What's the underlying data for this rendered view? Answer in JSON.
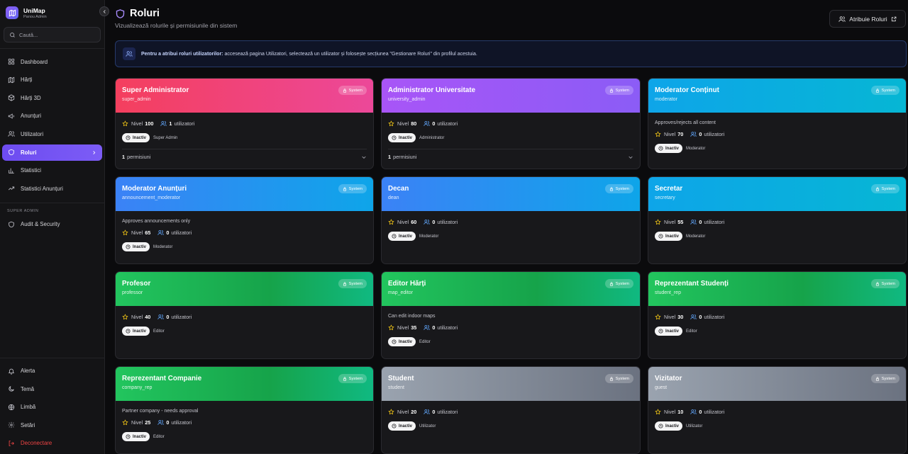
{
  "brand": {
    "name": "UniMap",
    "subtitle": "Panou Admin"
  },
  "search": {
    "placeholder": "Caută..."
  },
  "sidebar": {
    "items": [
      {
        "label": "Dashboard",
        "icon": "dashboard-icon"
      },
      {
        "label": "Hărți",
        "icon": "map-icon"
      },
      {
        "label": "Hărți 3D",
        "icon": "cube-icon"
      },
      {
        "label": "Anunțuri",
        "icon": "megaphone-icon"
      },
      {
        "label": "Utilizatori",
        "icon": "users-icon"
      },
      {
        "label": "Roluri",
        "icon": "shield-icon",
        "active": true
      },
      {
        "label": "Statistici",
        "icon": "bar-chart-icon"
      },
      {
        "label": "Statistici Anunțuri",
        "icon": "trend-icon"
      }
    ],
    "section_label": "SUPER ADMIN",
    "admin_items": [
      {
        "label": "Audit & Security",
        "icon": "shield-icon"
      }
    ],
    "bottom_items": [
      {
        "label": "Alerta",
        "icon": "bell-icon"
      },
      {
        "label": "Temă",
        "icon": "moon-icon"
      },
      {
        "label": "Limbă",
        "icon": "globe-icon"
      },
      {
        "label": "Setări",
        "icon": "gear-icon"
      },
      {
        "label": "Deconectare",
        "icon": "logout-icon"
      }
    ]
  },
  "header": {
    "title": "Roluri",
    "subtitle": "Vizualizează rolurile și permisiunile din sistem",
    "assign_button": "Atribuie Roluri"
  },
  "info": {
    "bold": "Pentru a atribui roluri utilizatorilor:",
    "text": " accesează pagina Utilizatori, selectează un utilizator și folosește secțiunea \"Gestionare Roluri\" din profilul acestuia."
  },
  "labels": {
    "system": "System",
    "level": "Nivel",
    "users": "utilizatori",
    "inactive": "Inactiv",
    "permissions": "permisiuni"
  },
  "colors": {
    "red": "#f43f5e",
    "purple": "#a855f7",
    "cyan": "#06b6d4",
    "blue": "#3b82f6",
    "green": "#22c55e",
    "gray": "#9aa3af",
    "accent": "#7c5cf6"
  },
  "roles": [
    {
      "name": "Super Administrator",
      "code": "super_admin",
      "level": "100",
      "users": "1",
      "tier": "Super Admin",
      "permissions": "1",
      "desc": "",
      "theme": "red"
    },
    {
      "name": "Administrator Universitate",
      "code": "university_admin",
      "level": "80",
      "users": "0",
      "tier": "Administrator",
      "permissions": "1",
      "desc": "",
      "theme": "purple"
    },
    {
      "name": "Moderator Conținut",
      "code": "moderator",
      "level": "70",
      "users": "0",
      "tier": "Moderator",
      "permissions": "",
      "desc": "Approves/rejects all content",
      "theme": "cyan"
    },
    {
      "name": "Moderator Anunțuri",
      "code": "announcement_moderator",
      "level": "65",
      "users": "0",
      "tier": "Moderator",
      "permissions": "",
      "desc": "Approves announcements only",
      "theme": "blue"
    },
    {
      "name": "Decan",
      "code": "dean",
      "level": "60",
      "users": "0",
      "tier": "Moderator",
      "permissions": "",
      "desc": "",
      "theme": "blue"
    },
    {
      "name": "Secretar",
      "code": "secretary",
      "level": "55",
      "users": "0",
      "tier": "Moderator",
      "permissions": "",
      "desc": "",
      "theme": "cyan"
    },
    {
      "name": "Profesor",
      "code": "professor",
      "level": "40",
      "users": "0",
      "tier": "Editor",
      "permissions": "",
      "desc": "",
      "theme": "green"
    },
    {
      "name": "Editor Hărți",
      "code": "map_editor",
      "level": "35",
      "users": "0",
      "tier": "Editor",
      "permissions": "",
      "desc": "Can edit indoor maps",
      "theme": "green"
    },
    {
      "name": "Reprezentant Studenți",
      "code": "student_rep",
      "level": "30",
      "users": "0",
      "tier": "Editor",
      "permissions": "",
      "desc": "",
      "theme": "green"
    },
    {
      "name": "Reprezentant Companie",
      "code": "company_rep",
      "level": "25",
      "users": "0",
      "tier": "Editor",
      "permissions": "",
      "desc": "Partner company - needs approval",
      "theme": "green"
    },
    {
      "name": "Student",
      "code": "student",
      "level": "20",
      "users": "0",
      "tier": "Utilizator",
      "permissions": "",
      "desc": "",
      "theme": "gray"
    },
    {
      "name": "Vizitator",
      "code": "guest",
      "level": "10",
      "users": "0",
      "tier": "Utilizator",
      "permissions": "",
      "desc": "",
      "theme": "gray"
    }
  ]
}
